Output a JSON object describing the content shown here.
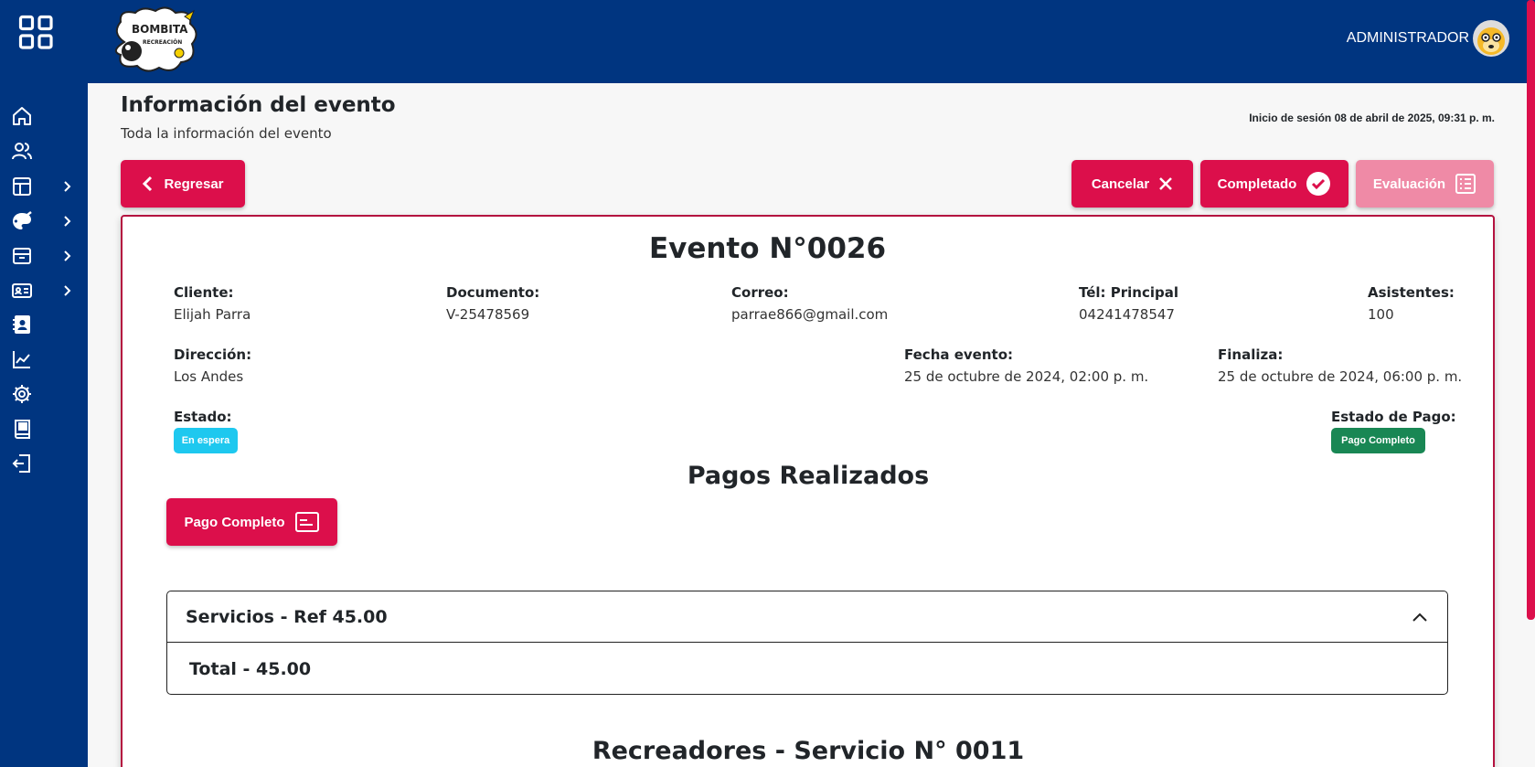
{
  "header": {
    "admin_label": "ADMINISTRADOR",
    "logo_text": "BOMBITA RECREACIÓN"
  },
  "sidebar": {
    "items": [
      {
        "icon": "home-icon",
        "chevron": false
      },
      {
        "icon": "users-icon",
        "chevron": false
      },
      {
        "icon": "layout-icon",
        "chevron": true
      },
      {
        "icon": "palette-icon",
        "chevron": true
      },
      {
        "icon": "archive-icon",
        "chevron": true
      },
      {
        "icon": "id-card-icon",
        "chevron": true
      },
      {
        "icon": "contact-book-icon",
        "chevron": false
      },
      {
        "icon": "chart-line-icon",
        "chevron": false
      },
      {
        "icon": "gear-icon",
        "chevron": false
      },
      {
        "icon": "book-icon",
        "chevron": false
      },
      {
        "icon": "logout-icon",
        "chevron": false
      }
    ]
  },
  "page": {
    "title": "Información del evento",
    "subtitle": "Toda la información del evento",
    "session": "Inicio de sesión 08 de abril de 2025, 09:31 p. m."
  },
  "actions": {
    "back": "Regresar",
    "cancel": "Cancelar",
    "completed": "Completado",
    "evaluation": "Evaluación"
  },
  "event": {
    "title": "Evento N°0026",
    "client_label": "Cliente:",
    "client": "Elijah Parra",
    "document_label": "Documento:",
    "document": "V-25478569",
    "email_label": "Correo:",
    "email": "parrae866@gmail.com",
    "phone_label": "Tél: Principal",
    "phone": "04241478547",
    "attendees_label": "Asistentes:",
    "attendees": "100",
    "address_label": "Dirección:",
    "address": "Los Andes",
    "date_label": "Fecha evento:",
    "date": "25 de octubre de 2024, 02:00 p. m.",
    "end_label": "Finaliza:",
    "end": "25 de octubre de 2024, 06:00 p. m.",
    "status_label": "Estado:",
    "status": "En espera",
    "payment_status_label": "Estado de Pago:",
    "payment_status": "Pago Completo"
  },
  "payments": {
    "title": "Pagos Realizados",
    "button": "Pago Completo"
  },
  "services": {
    "header": "Servicios - Ref 45.00",
    "total": "Total - 45.00"
  },
  "recreators": {
    "title": "Recreadores - Servicio N° 0011"
  },
  "colors": {
    "primary": "#003580",
    "accent": "#dc0f4b",
    "status_waiting": "#1ec8ef",
    "status_paid": "#198754"
  }
}
